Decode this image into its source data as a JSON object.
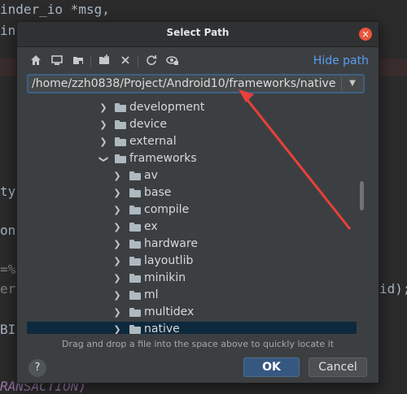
{
  "background_code": {
    "lines": [
      "inder_io *msg,",
      "inc",
      "ty;",
      "on_",
      "=%c",
      "erge",
      "BIN",
      "RANSACTION)"
    ],
    "right_fragment": "id);"
  },
  "dialog": {
    "title": "Select Path",
    "close_label": "×",
    "toolbar": {
      "icons": [
        "home-icon",
        "desktop-icon",
        "project-folder-icon",
        "new-folder-icon",
        "delete-icon",
        "refresh-icon",
        "show-hidden-icon"
      ],
      "hide_path_label": "Hide path"
    },
    "path": {
      "value": "/home/zzh0838/Project/Android10/frameworks/native"
    },
    "tree": {
      "items": [
        {
          "label": "development",
          "level": 1,
          "expanded": false
        },
        {
          "label": "device",
          "level": 1,
          "expanded": false
        },
        {
          "label": "external",
          "level": 1,
          "expanded": false
        },
        {
          "label": "frameworks",
          "level": 1,
          "expanded": true
        },
        {
          "label": "av",
          "level": 2,
          "expanded": false
        },
        {
          "label": "base",
          "level": 2,
          "expanded": false
        },
        {
          "label": "compile",
          "level": 2,
          "expanded": false
        },
        {
          "label": "ex",
          "level": 2,
          "expanded": false
        },
        {
          "label": "hardware",
          "level": 2,
          "expanded": false
        },
        {
          "label": "layoutlib",
          "level": 2,
          "expanded": false
        },
        {
          "label": "minikin",
          "level": 2,
          "expanded": false
        },
        {
          "label": "ml",
          "level": 2,
          "expanded": false
        },
        {
          "label": "multidex",
          "level": 2,
          "expanded": false
        },
        {
          "label": "native",
          "level": 2,
          "expanded": false,
          "selected": true
        }
      ]
    },
    "hint": "Drag and drop a file into the space above to quickly locate it",
    "help_label": "?",
    "ok_label": "OK",
    "cancel_label": "Cancel"
  },
  "colors": {
    "accent": "#589df6",
    "selected_row": "#0d293e",
    "ok_button": "#365880",
    "close_button": "#e9553a",
    "arrow": "#e8403a"
  }
}
